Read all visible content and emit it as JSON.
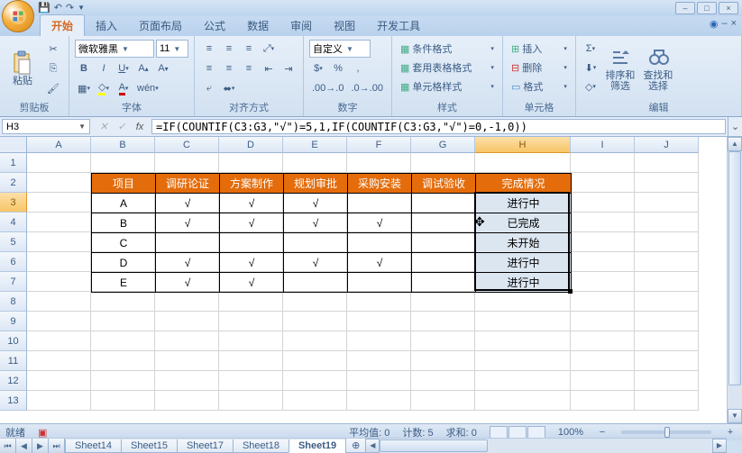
{
  "tabs": {
    "home": "开始",
    "insert": "插入",
    "layout": "页面布局",
    "formula": "公式",
    "data": "数据",
    "review": "审阅",
    "view": "视图",
    "dev": "开发工具"
  },
  "ribbon": {
    "clipboard": {
      "paste": "粘贴",
      "label": "剪贴板"
    },
    "font": {
      "name": "微软雅黑",
      "size": "11",
      "label": "字体"
    },
    "align": {
      "label": "对齐方式"
    },
    "number": {
      "format": "自定义",
      "label": "数字"
    },
    "styles": {
      "cond": "条件格式",
      "table": "套用表格格式",
      "cell": "单元格样式",
      "label": "样式"
    },
    "cells": {
      "insert": "插入",
      "delete": "删除",
      "format": "格式",
      "label": "单元格"
    },
    "editing": {
      "sort": "排序和\n筛选",
      "find": "查找和\n选择",
      "label": "编辑"
    }
  },
  "name_box": "H3",
  "formula": "=IF(COUNTIF(C3:G3,\"√\")=5,1,IF(COUNTIF(C3:G3,\"√\")=0,-1,0))",
  "columns": [
    "A",
    "B",
    "C",
    "D",
    "E",
    "F",
    "G",
    "H",
    "I",
    "J"
  ],
  "rows": [
    "1",
    "2",
    "3",
    "4",
    "5",
    "6",
    "7",
    "8",
    "9",
    "10",
    "11",
    "12",
    "13"
  ],
  "headers": {
    "item": "项目",
    "c1": "调研论证",
    "c2": "方案制作",
    "c3": "规划审批",
    "c4": "采购安装",
    "c5": "调试验收",
    "status": "完成情况"
  },
  "data_rows": [
    {
      "item": "A",
      "c1": "√",
      "c2": "√",
      "c3": "√",
      "c4": "",
      "c5": "",
      "status": "进行中"
    },
    {
      "item": "B",
      "c1": "√",
      "c2": "√",
      "c3": "√",
      "c4": "√",
      "c5": "",
      "status": "已完成"
    },
    {
      "item": "C",
      "c1": "",
      "c2": "",
      "c3": "",
      "c4": "",
      "c5": "",
      "status": "未开始"
    },
    {
      "item": "D",
      "c1": "√",
      "c2": "√",
      "c3": "√",
      "c4": "√",
      "c5": "",
      "status": "进行中"
    },
    {
      "item": "E",
      "c1": "√",
      "c2": "√",
      "c3": "",
      "c4": "",
      "c5": "",
      "status": "进行中"
    }
  ],
  "active_cell_col": 7,
  "sheets": [
    "Sheet14",
    "Sheet15",
    "Sheet17",
    "Sheet18",
    "Sheet19"
  ],
  "active_sheet": "Sheet19",
  "status": {
    "ready": "就绪",
    "avg": "平均值: 0",
    "count": "计数: 5",
    "sum": "求和: 0",
    "zoom": "100%"
  }
}
